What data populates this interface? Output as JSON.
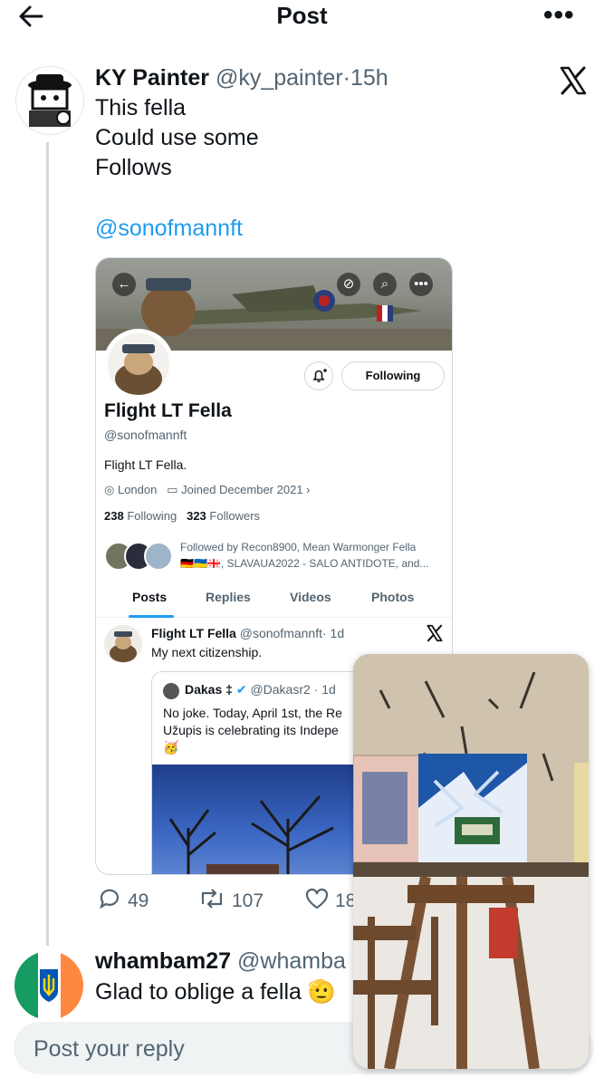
{
  "header": {
    "title": "Post",
    "back_icon": "arrow-left-icon",
    "more_icon": "more-horizontal-icon"
  },
  "main_post": {
    "display_name": "KY Painter",
    "handle": "@ky_painter",
    "separator": "·",
    "time": "15h",
    "lines": [
      "This fella",
      "Could use some",
      "Follows"
    ],
    "mention": "@sonofmannft",
    "avatar_icon": "pixel-art-avatar-icon",
    "brand_icon": "x-logo-icon"
  },
  "embedded_profile": {
    "display_name": "Flight LT Fella",
    "handle": "@sonofmannft",
    "bio": "Flight LT Fella.",
    "location": "London",
    "joined": "Joined December 2021",
    "following_count": "238",
    "following_label": "Following",
    "followers_count": "323",
    "followers_label": "Followers",
    "follow_button": "Following",
    "followed_by_line1": "Followed by Recon8900, Mean Warmonger Fella",
    "followed_by_line2": "🇩🇪🇺🇦🇬🇪, SLAVAUA2022 - SALO ANTIDOTE, and...",
    "tabs": [
      "Posts",
      "Replies",
      "Videos",
      "Photos"
    ],
    "inner_post": {
      "display_name": "Flight LT Fella",
      "handle": "@sonofmannft",
      "time": "· 1d",
      "text": "My next citizenship."
    },
    "quote": {
      "display_name": "Dakas ‡",
      "handle": "@Dakasr2",
      "time": "· 1d",
      "text_line1": "No joke. Today, April 1st, the Re",
      "text_line2": "Užupis is celebrating its Indepe",
      "emoji": "🥳"
    }
  },
  "actions": {
    "replies": "49",
    "reposts": "107",
    "likes": "18"
  },
  "reply": {
    "display_name": "whambam27",
    "handle": "@whamba",
    "text": "Glad to oblige a fella 🫡"
  },
  "composer": {
    "placeholder": "Post your reply"
  },
  "colors": {
    "accent": "#1d9bf0",
    "muted": "#536471",
    "divider": "#cfd9de"
  }
}
